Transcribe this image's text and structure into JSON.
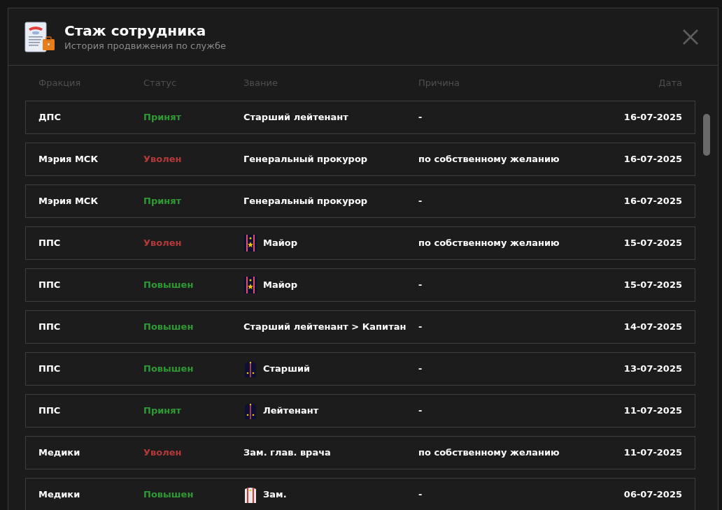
{
  "window": {
    "title": "Стаж сотрудника",
    "subtitle": "История продвижения по службе"
  },
  "table": {
    "columns": [
      "Фракция",
      "Статус",
      "Звание",
      "Причина",
      "Дата"
    ],
    "rows": [
      {
        "faction": "ДПС",
        "status": {
          "text": "Принят",
          "kind": "accepted"
        },
        "rank": {
          "text": "Старший лейтенант",
          "kind": "plain"
        },
        "reason": "-",
        "date": "16-07-2025"
      },
      {
        "faction": "Мэрия МСК",
        "status": {
          "text": "Уволен",
          "kind": "fired"
        },
        "rank": {
          "text": "Генеральный прокурор",
          "kind": "plain"
        },
        "reason": "по собственному желанию",
        "date": "16-07-2025"
      },
      {
        "faction": "Мэрия МСК",
        "status": {
          "text": "Принят",
          "kind": "accepted"
        },
        "rank": {
          "text": "Генеральный прокурор",
          "kind": "plain"
        },
        "reason": "-",
        "date": "16-07-2025"
      },
      {
        "faction": "ППС",
        "status": {
          "text": "Уволен",
          "kind": "fired"
        },
        "rank": {
          "text": "Майор",
          "kind": "two-stripes"
        },
        "reason": "по собственному желанию",
        "date": "15-07-2025"
      },
      {
        "faction": "ППС",
        "status": {
          "text": "Повышен",
          "kind": "promoted"
        },
        "rank": {
          "text": "Майор",
          "kind": "two-stripes"
        },
        "reason": "-",
        "date": "15-07-2025"
      },
      {
        "faction": "ППС",
        "status": {
          "text": "Повышен",
          "kind": "promoted"
        },
        "rank": {
          "text": "Старший лейтенант > Капитан",
          "kind": "plain"
        },
        "reason": "-",
        "date": "14-07-2025"
      },
      {
        "faction": "ППС",
        "status": {
          "text": "Повышен",
          "kind": "promoted"
        },
        "rank": {
          "text": "Старший",
          "kind": "one-stripe"
        },
        "reason": "-",
        "date": "13-07-2025"
      },
      {
        "faction": "ППС",
        "status": {
          "text": "Принят",
          "kind": "accepted"
        },
        "rank": {
          "text": "Лейтенант",
          "kind": "one-stripe"
        },
        "reason": "-",
        "date": "11-07-2025"
      },
      {
        "faction": "Медики",
        "status": {
          "text": "Уволен",
          "kind": "fired"
        },
        "rank": {
          "text": "Зам. глав. врача",
          "kind": "plain"
        },
        "reason": "по собственному желанию",
        "date": "11-07-2025"
      },
      {
        "faction": "Медики",
        "status": {
          "text": "Повышен",
          "kind": "promoted"
        },
        "rank": {
          "text": "Зам.",
          "kind": "white-strap"
        },
        "reason": "-",
        "date": "06-07-2025"
      }
    ]
  }
}
